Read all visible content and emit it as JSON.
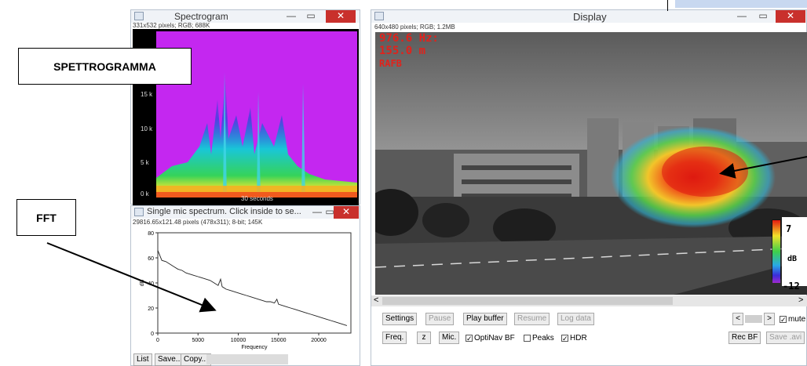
{
  "spectrogram_window": {
    "title": "Spectrogram",
    "info": "331x532 pixels; RGB; 688K",
    "y_ticks": [
      "15 k",
      "10 k",
      "5 k",
      "0 k"
    ],
    "x_label": "30 seconds"
  },
  "display_window": {
    "title": "Display",
    "info": "640x480 pixels; RGB; 1.2MB",
    "overlay": {
      "frequency": "976.6 Hz:",
      "distance": "155.0 m",
      "mode": "RAFB"
    },
    "colorbar": {
      "max": "7",
      "unit": "dB",
      "min": "-12"
    }
  },
  "spectrum_window": {
    "title": "Single mic spectrum. Click inside to se...",
    "info": "29816.65x121.48 pixels (478x311); 8-bit; 145K",
    "buttons": {
      "list": "List",
      "save": "Save...",
      "copy": "Copy..."
    }
  },
  "controls": {
    "settings": "Settings",
    "pause": "Pause",
    "play_buffer": "Play buffer",
    "resume": "Resume",
    "log_data": "Log data",
    "freq": "Freq.",
    "z": "z",
    "mic": "Mic.",
    "optinav": "OptiNav BF",
    "peaks": "Peaks",
    "hdr": "HDR",
    "rec_bf": "Rec BF",
    "save_avi": "Save .avi",
    "mute": "mute"
  },
  "callouts": {
    "spettrogramma": "SPETTROGRAMMA",
    "fft": "FFT"
  },
  "chart_data": {
    "type": "line",
    "x_ticks": [
      "0",
      "5000",
      "10000",
      "15000",
      "20000"
    ],
    "y_ticks": [
      "0",
      "20",
      "40",
      "60",
      "80"
    ],
    "xlabel": "Frequency",
    "ylabel": "dB",
    "xlim": [
      0,
      24000
    ],
    "ylim": [
      0,
      80
    ],
    "x": [
      0,
      500,
      1000,
      1500,
      2000,
      2500,
      3000,
      3500,
      4000,
      4500,
      5000,
      5500,
      6000,
      6500,
      7000,
      7500,
      7800,
      8000,
      8500,
      9000,
      9500,
      10000,
      10500,
      11000,
      11500,
      12000,
      12500,
      13000,
      13500,
      14000,
      14500,
      14800,
      15000,
      15500,
      16000,
      16500,
      17000,
      17500,
      18000,
      18500,
      19000,
      19500,
      20000,
      20500,
      21000,
      21500,
      22000,
      22500,
      23000,
      23500
    ],
    "y": [
      66,
      58,
      57,
      55,
      53,
      51,
      50,
      48,
      47,
      46,
      45,
      44,
      43,
      42,
      40,
      38,
      43,
      37,
      35,
      34,
      33,
      32,
      31,
      30,
      29,
      28,
      27,
      26,
      25,
      25,
      24,
      27,
      23,
      22,
      21,
      20,
      19,
      18,
      17,
      16,
      15,
      14,
      13,
      12,
      11,
      10,
      9,
      8,
      7,
      6
    ]
  }
}
